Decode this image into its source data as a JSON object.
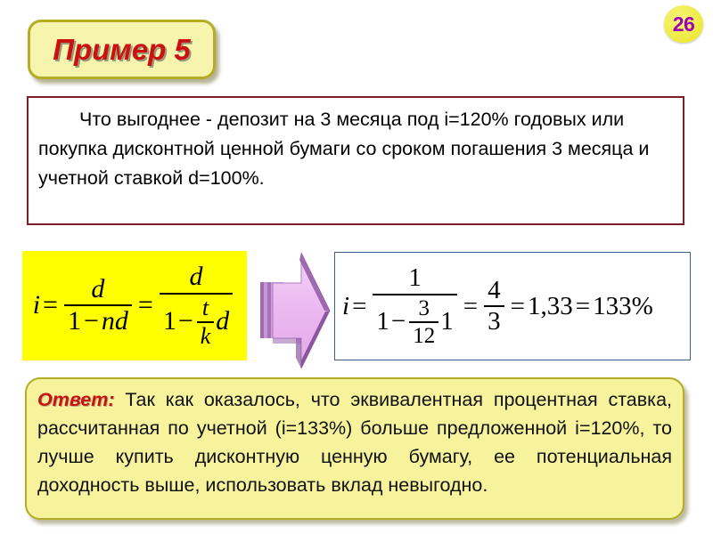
{
  "slide": {
    "page_number": "26",
    "title": "Пример 5",
    "background_color": "#ffffff"
  },
  "colors": {
    "title_text": "#cc1111",
    "title_fill": "#f7f5ad",
    "title_border": "#b3ad25",
    "badge_fill": "#f2ee55",
    "badge_text": "#9c03b5",
    "problem_border": "#7d1f28",
    "formula_left_fill": "#ffff00",
    "formula_right_border": "#3b6188",
    "answer_fill": "#f6f39c",
    "answer_border": "#b3ad25",
    "arrow_fill": "#e7b3ee",
    "arrow_edge": "#8d5aa0"
  },
  "problem": {
    "lines": [
      "Что выгоднее - депозит на 3 месяца под i=120% годовых или покупка дисконтной ценной бумаги со сроком погашения 3 месяца и учетной ставкой d=100%."
    ],
    "line1": "Что выгоднее - депозит на 3 месяца под i=120%",
    "line2": "годовых или покупка дисконтной ценной бумаги со",
    "line3": "сроком погашения 3 месяца и учетной ставкой",
    "line4": "d=100%."
  },
  "formula_left": {
    "latex": "i = \\frac{d}{1-nd} = \\frac{d}{1-\\frac{t}{k}d}",
    "lhs": "i",
    "eq1": "=",
    "frac1_num": "d",
    "frac1_den_one": "1",
    "frac1_den_minus": "−",
    "frac1_den_nd": "nd",
    "eq2": "=",
    "frac2_num": "d",
    "frac2_den_one": "1",
    "frac2_den_minus": "−",
    "frac2_den_t": "t",
    "frac2_den_k": "k",
    "frac2_den_d": "d"
  },
  "formula_right": {
    "latex": "i = \\frac{1}{1-\\frac{3}{12}1} = \\frac{4}{3} = 1,33 = 133\\%",
    "lhs": "i",
    "eq1": "=",
    "frac1_num": "1",
    "frac1_den_one": "1",
    "frac1_den_minus": "−",
    "frac1_den_inner_num": "3",
    "frac1_den_inner_den": "12",
    "frac1_den_tail": "1",
    "eq2": "=",
    "frac2_num": "4",
    "frac2_den": "3",
    "eq3": "=",
    "decimal_value": "1,33",
    "eq4": "=",
    "percent_value": "133%"
  },
  "arrow": {
    "direction": "right",
    "label": "arrow-right-3d"
  },
  "answer": {
    "label": "Ответ:",
    "text": "Так как оказалось, что эквивалентная процентная ставка, рассчитанная по учетной (i=133%) больше предложенной i=120%, то лучше купить дисконтную ценную бумагу, ее потенциальная доходность выше, использовать вклад невыгодно.",
    "line1": "Так как оказалось, что эквивалентная",
    "line2": "процентная ставка, рассчитанная по учетной (i=133%)",
    "line3": "больше предложенной i=120%, то лучше купить",
    "line4": "дисконтную ценную бумагу, ее потенциальная",
    "line5": "доходность выше, использовать вклад невыгодно."
  }
}
